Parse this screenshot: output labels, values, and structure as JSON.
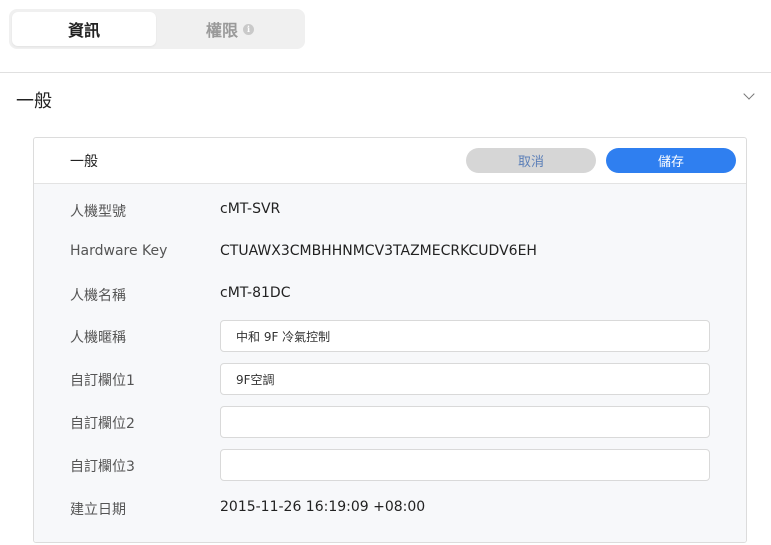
{
  "tabs": [
    {
      "label": "資訊",
      "active": true
    },
    {
      "label": "權限",
      "active": false
    }
  ],
  "section": {
    "title": "一般"
  },
  "card": {
    "title": "一般",
    "cancel_label": "取消",
    "save_label": "儲存"
  },
  "fields": {
    "model": {
      "label": "人機型號",
      "value": "cMT-SVR"
    },
    "hardware_key": {
      "label": "Hardware Key",
      "value": "CTUAWX3CMBHHNMCV3TAZMECRKCUDV6EH"
    },
    "hmi_name": {
      "label": "人機名稱",
      "value": "cMT-81DC"
    },
    "nickname": {
      "label": "人機暱稱",
      "value": "中和 9F 冷氣控制"
    },
    "custom1": {
      "label": "自訂欄位1",
      "value": "9F空調"
    },
    "custom2": {
      "label": "自訂欄位2",
      "value": ""
    },
    "custom3": {
      "label": "自訂欄位3",
      "value": ""
    },
    "created": {
      "label": "建立日期",
      "value": "2015-11-26 16:19:09 +08:00"
    }
  },
  "colors": {
    "accent": "#2f7ff0",
    "cancel_bg": "#d6d6d6",
    "cancel_text": "#5b7fb8"
  },
  "icons": {
    "permission_tab": "info-icon",
    "section_toggle": "chevron-down-icon"
  }
}
